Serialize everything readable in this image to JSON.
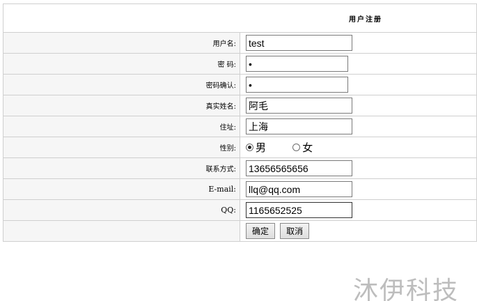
{
  "form": {
    "title": "用户注册",
    "fields": {
      "username": {
        "label": "用户名:",
        "value": "test"
      },
      "password": {
        "label": "密 码:",
        "value": "•"
      },
      "password_confirm": {
        "label": "密码确认:",
        "value": "•"
      },
      "real_name": {
        "label": "真实姓名:",
        "value": "阿毛"
      },
      "address": {
        "label": "住址:",
        "value": "上海"
      },
      "gender": {
        "label": "性别:",
        "option_male": "男",
        "option_female": "女",
        "selected": "男"
      },
      "contact": {
        "label": "联系方式:",
        "value": "13656565656"
      },
      "email": {
        "label": "E-mail:",
        "value": "llq@qq.com"
      },
      "qq": {
        "label": "QQ:",
        "value": "1165652525"
      }
    },
    "buttons": {
      "submit_label": "确定",
      "cancel_label": "取消"
    }
  },
  "watermark": "沐伊科技"
}
